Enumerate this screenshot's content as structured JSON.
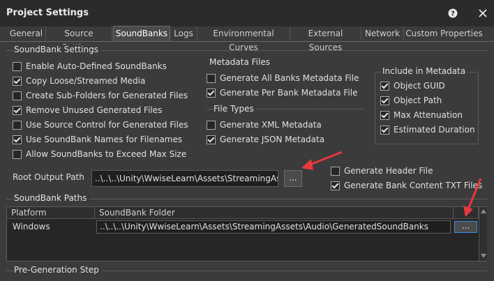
{
  "window": {
    "title": "Project Settings",
    "help_icon": "help-icon",
    "close_icon": "close-icon"
  },
  "tabs": [
    {
      "label": "General"
    },
    {
      "label": "Source Settings"
    },
    {
      "label": "SoundBanks",
      "active": true
    },
    {
      "label": "Logs"
    },
    {
      "label": "Environmental Curves"
    },
    {
      "label": "External Sources"
    },
    {
      "label": "Network"
    },
    {
      "label": "Custom Properties"
    }
  ],
  "soundbank_settings": {
    "header": "SoundBank Settings",
    "options": [
      {
        "label": "Enable Auto-Defined SoundBanks",
        "checked": false
      },
      {
        "label": "Copy Loose/Streamed Media",
        "checked": true
      },
      {
        "label": "Create Sub-Folders for Generated Files",
        "checked": false
      },
      {
        "label": "Remove Unused Generated Files",
        "checked": true
      },
      {
        "label": "Use Source Control for Generated Files",
        "checked": false
      },
      {
        "label": "Use SoundBank Names for Filenames",
        "checked": true
      },
      {
        "label": "Allow SoundBanks to Exceed Max Size",
        "checked": false
      }
    ]
  },
  "metadata_files": {
    "header": "Metadata Files",
    "options": [
      {
        "label": "Generate All Banks Metadata File",
        "checked": false
      },
      {
        "label": "Generate Per Bank Metadata File",
        "checked": true
      }
    ],
    "file_types_header": "File Types",
    "file_types": [
      {
        "label": "Generate XML Metadata",
        "checked": false
      },
      {
        "label": "Generate JSON Metadata",
        "checked": true
      }
    ],
    "include_header": "Include in Metadata",
    "include": [
      {
        "label": "Object GUID",
        "checked": true
      },
      {
        "label": "Object Path",
        "checked": true
      },
      {
        "label": "Max Attenuation",
        "checked": true
      },
      {
        "label": "Estimated Duration",
        "checked": true
      }
    ]
  },
  "root_output": {
    "label": "Root Output Path",
    "value": "..\\..\\..\\Unity\\WwiseLearn\\Assets\\StreamingAssets",
    "browse_label": "..."
  },
  "extra_options": [
    {
      "label": "Generate Header File",
      "checked": false
    },
    {
      "label": "Generate Bank Content TXT Files",
      "checked": true
    }
  ],
  "soundbank_paths": {
    "header": "SoundBank Paths",
    "columns": [
      "Platform",
      "SoundBank Folder"
    ],
    "rows": [
      {
        "platform": "Windows",
        "folder": "..\\..\\..\\Unity\\WwiseLearn\\Assets\\StreamingAssets\\Audio\\GeneratedSoundBanks",
        "browse_label": "..."
      }
    ]
  },
  "pre_generation": {
    "header": "Pre-Generation Step"
  },
  "colors": {
    "window_bg": "#3b3b3b",
    "titlebar_bg": "#2b2b2b",
    "field_bg": "#1f1f1f",
    "annotation_arrow": "#e8383d",
    "focus_border": "#3d8ee6"
  }
}
